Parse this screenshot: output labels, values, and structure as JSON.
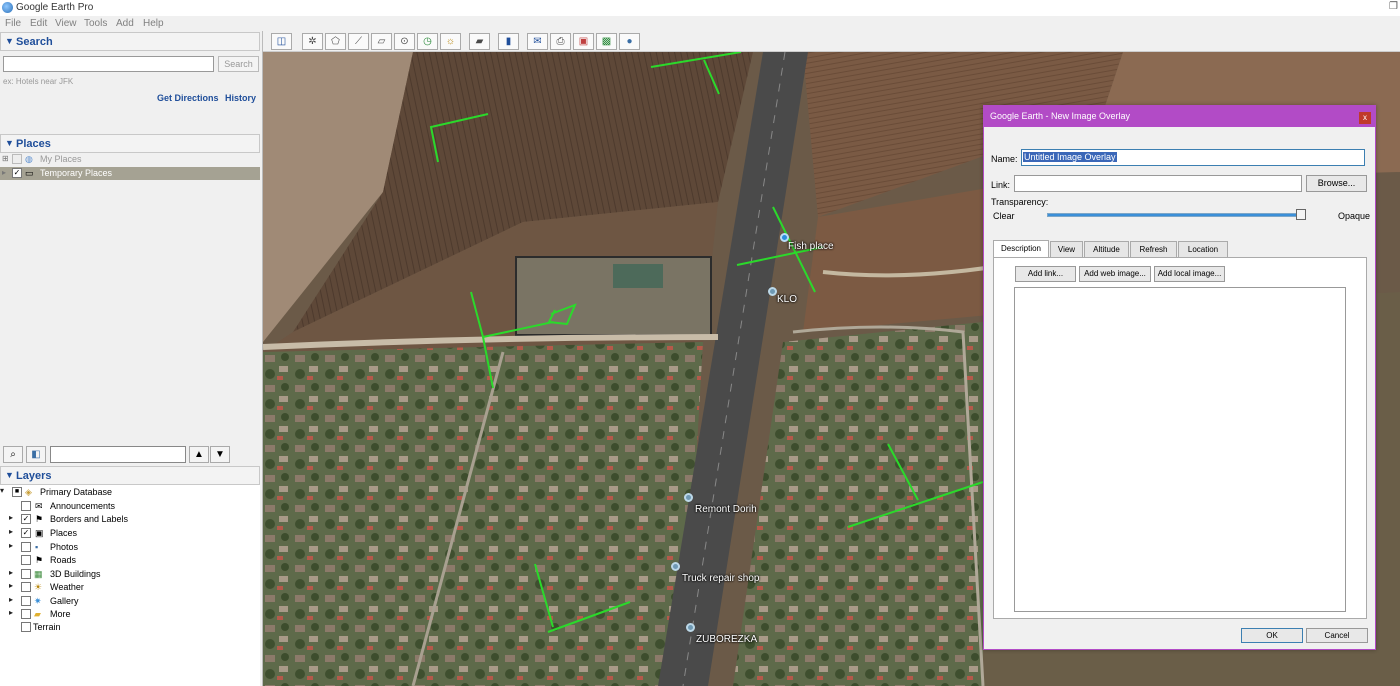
{
  "app": {
    "title": "Google Earth Pro",
    "menu": [
      "File",
      "Edit",
      "View",
      "Tools",
      "Add",
      "Help"
    ]
  },
  "search": {
    "header": "Search",
    "button": "Search",
    "hint": "ex: Hotels near JFK",
    "get_directions": "Get Directions",
    "history": "History"
  },
  "places": {
    "header": "Places",
    "items": [
      {
        "label": "My Places",
        "checked": false,
        "selected": false
      },
      {
        "label": "Temporary Places",
        "checked": true,
        "selected": true
      }
    ]
  },
  "layers": {
    "header": "Layers",
    "items": [
      {
        "label": "Primary Database",
        "checked": "partial",
        "expander": "▾",
        "icon": "database-icon"
      },
      {
        "label": "Announcements",
        "checked": false,
        "expander": "",
        "icon": "envelope-icon"
      },
      {
        "label": "Borders and Labels",
        "checked": true,
        "expander": "▸",
        "icon": "flag-icon"
      },
      {
        "label": "Places",
        "checked": true,
        "expander": "▸",
        "icon": "square-icon"
      },
      {
        "label": "Photos",
        "checked": false,
        "expander": "▸",
        "icon": "photo-icon"
      },
      {
        "label": "Roads",
        "checked": false,
        "expander": "",
        "icon": "road-icon"
      },
      {
        "label": "3D Buildings",
        "checked": false,
        "expander": "▸",
        "icon": "building-icon"
      },
      {
        "label": "Weather",
        "checked": false,
        "expander": "▸",
        "icon": "sun-icon"
      },
      {
        "label": "Gallery",
        "checked": false,
        "expander": "▸",
        "icon": "star-icon"
      },
      {
        "label": "More",
        "checked": false,
        "expander": "▸",
        "icon": "folder-icon"
      },
      {
        "label": "Terrain",
        "checked": false,
        "expander": "",
        "icon": ""
      }
    ]
  },
  "map": {
    "labels": [
      "Fish place",
      "KLO",
      "Remont Dorih",
      "Truck repair shop",
      "ZUBOREZKA"
    ]
  },
  "dialog": {
    "title": "Google Earth - New Image Overlay",
    "close": "x",
    "name_label": "Name:",
    "name_value": "Untitled Image Overlay",
    "link_label": "Link:",
    "browse": "Browse...",
    "transparency_label": "Transparency:",
    "clear": "Clear",
    "opaque": "Opaque",
    "transparency_value": 0.98,
    "tabs": [
      "Description",
      "View",
      "Altitude",
      "Refresh",
      "Location"
    ],
    "add_link": "Add link...",
    "add_web_image": "Add web image...",
    "add_local_image": "Add local image...",
    "ok": "OK",
    "cancel": "Cancel"
  },
  "colors": {
    "dialog_accent": "#b24bc6",
    "header_text": "#1f4e9a",
    "path_lines": "#2bd92b"
  }
}
